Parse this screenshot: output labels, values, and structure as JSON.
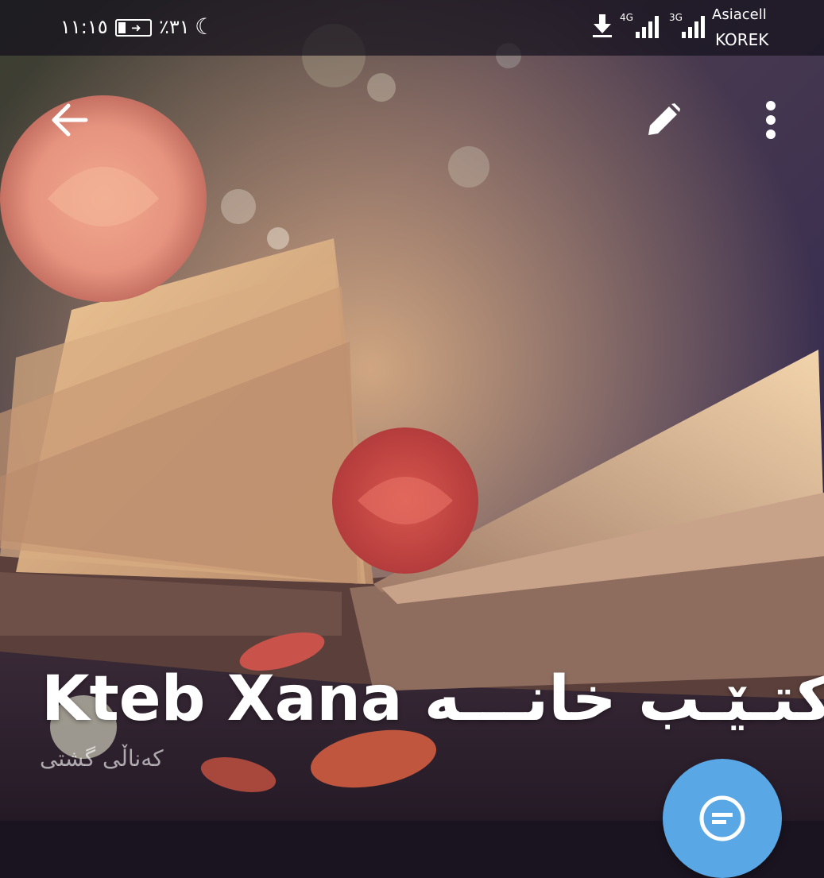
{
  "status_bar": {
    "time": "١١:١٥",
    "battery_percent": "٪٣١",
    "network_type_1": "4G",
    "network_type_2": "3G",
    "carrier_1": "Asiacell",
    "carrier_2": "KOREK",
    "icons": [
      "battery-charging-icon",
      "moon-icon",
      "download-icon",
      "signal-icon"
    ]
  },
  "toolbar": {
    "back_icon": "arrow-back-icon",
    "edit_icon": "pencil-icon",
    "more_icon": "more-vertical-icon"
  },
  "channel": {
    "title": "Kteb Xana کتـێـب خانـــه",
    "subtitle": "کەناڵی گشتی"
  },
  "fab": {
    "icon": "message-icon",
    "color": "#5aa7e6"
  }
}
